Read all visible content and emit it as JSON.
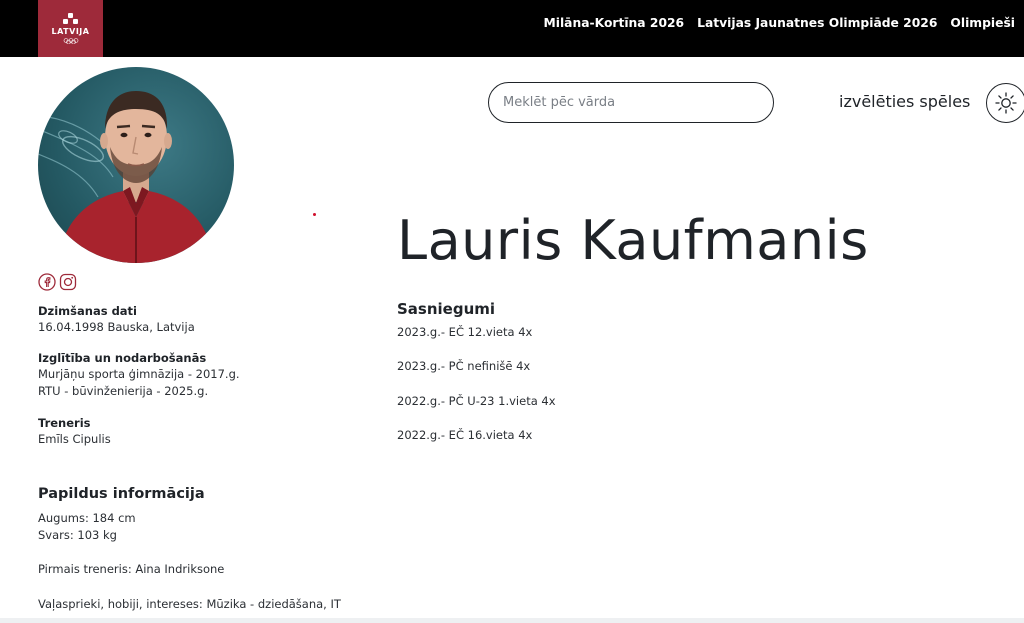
{
  "header": {
    "logo_text": "LATVIJA",
    "nav": [
      "Milāna-Kortīna 2026",
      "Latvijas Jaunatnes Olimpiāde 2026",
      "Olimpieši"
    ]
  },
  "search": {
    "placeholder": "Meklēt pēc vārda"
  },
  "games": {
    "label": "izvēlēties spēles"
  },
  "athlete": {
    "name": "Lauris Kaufmanis"
  },
  "info": {
    "birth_label": "Dzimšanas dati",
    "birth_value": "16.04.1998 Bauska, Latvija",
    "education_label": "Izglītība un nodarbošanās",
    "education_values": [
      "Murjāņu sporta ģimnāzija - 2017.g.",
      "RTU - būvinženierija - 2025.g."
    ],
    "coach_label": "Treneris",
    "coach_value": "Emīls Cipulis"
  },
  "extra": {
    "title": "Papildus informācija",
    "height": "Augums: 184 cm",
    "weight": "Svars: 103 kg",
    "first_coach": "Pirmais treneris: Aina Indriksone",
    "hobbies": "Vaļasprieki, hobiji, intereses: Mūzika - dziedāšana, IT"
  },
  "achievements": {
    "title": "Sasniegumi",
    "items": [
      "2023.g.- EČ 12.vieta 4x",
      "2023.g.- PČ nefinišē 4x",
      "2022.g.- PČ U-23 1.vieta 4x",
      "2022.g.- EČ 16.vieta 4x"
    ]
  },
  "colors": {
    "brand_red": "#9e2a3a",
    "header_bg": "#000000",
    "text": "#1f2328"
  },
  "icons": [
    "facebook-icon",
    "instagram-icon",
    "sun-icon"
  ]
}
